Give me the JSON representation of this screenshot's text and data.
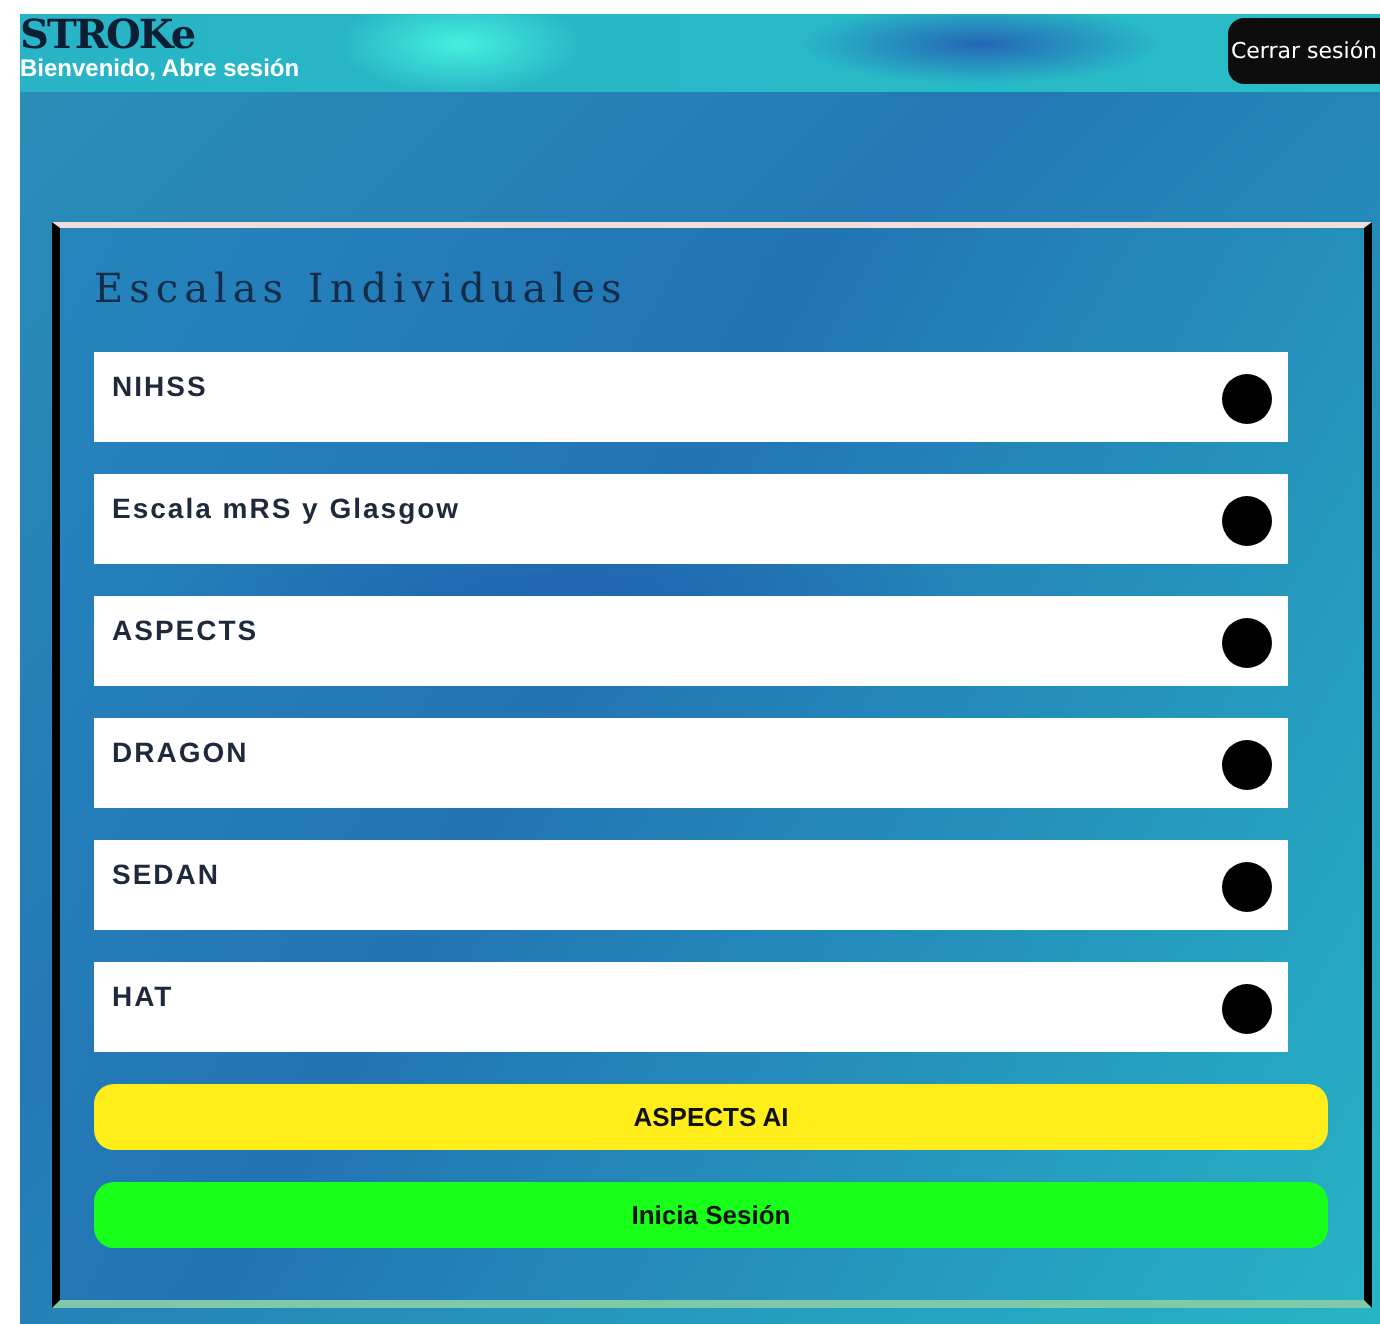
{
  "header": {
    "logo": "STROKe",
    "subtitle": "Bienvenido, Abre sesión",
    "logout_button": "Cerrar sesión"
  },
  "panel": {
    "title": "Escalas Individuales",
    "scales": [
      {
        "label": "NIHSS"
      },
      {
        "label": "Escala mRS y Glasgow"
      },
      {
        "label": "ASPECTS"
      },
      {
        "label": "DRAGON"
      },
      {
        "label": "SEDAN"
      },
      {
        "label": "HAT"
      }
    ],
    "buttons": [
      {
        "label": "ASPECTS AI",
        "color": "#ffee1a"
      },
      {
        "label": "Inicia Sesión",
        "color": "#18ff1a"
      }
    ]
  }
}
